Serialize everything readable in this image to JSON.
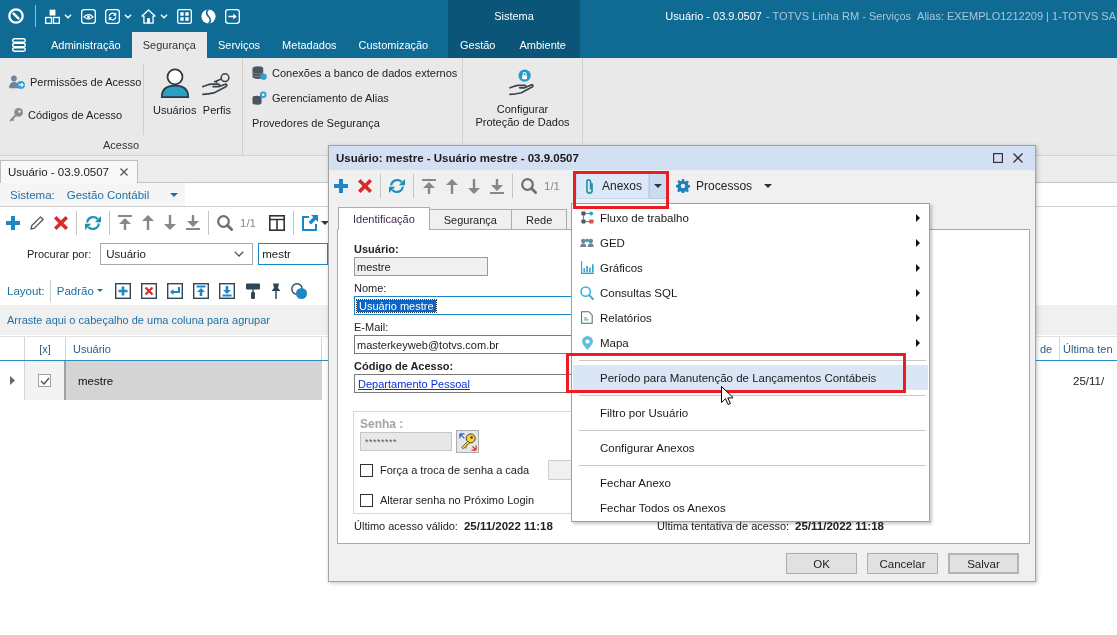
{
  "title_bar": {
    "title": "Usuário - 03.9.0507",
    "product": "- TOTVS Linha RM - Serviços",
    "alias": "Alias: EXEMPLO1212209 | 1-TOTVS SA"
  },
  "ribbon": {
    "tabs": [
      {
        "label": "Administração",
        "selected": false
      },
      {
        "label": "Segurança",
        "selected": true
      },
      {
        "label": "Serviços",
        "selected": false
      },
      {
        "label": "Metadados",
        "selected": false
      },
      {
        "label": "Customização",
        "selected": false
      }
    ],
    "context": {
      "label": "Sistema",
      "tabs": [
        {
          "label": "Gestão",
          "selected": false
        },
        {
          "label": "Ambiente",
          "selected": false
        }
      ]
    },
    "groups": [
      {
        "label": "Acesso",
        "small_buttons": [
          "Permissões de Acesso",
          "Códigos de Acesso"
        ],
        "large_buttons": [
          "Usuários",
          "Perfis"
        ]
      },
      {
        "small_buttons": [
          "Conexões a banco de dados externos",
          "Gerenciamento de Alias",
          "Provedores de Segurança"
        ]
      },
      {
        "large_buttons": [
          "Configurar Proteção de Dados"
        ]
      }
    ]
  },
  "document_tabs": [
    {
      "label": "Usuário - 03.9.0507",
      "selected": true
    }
  ],
  "system_selector": {
    "label": "Sistema:",
    "value": "Gestão Contábil"
  },
  "toolbar": {
    "record_counter": "1/1"
  },
  "search": {
    "label": "Procurar por:",
    "field": "Usuário",
    "value": "mestr"
  },
  "layout_bar": {
    "label": "Layout:",
    "value": "Padrão"
  },
  "group_panel": {
    "hint": "Arraste aqui o cabeçalho de uma coluna para agrupar"
  },
  "table": {
    "columns": [
      "[x]",
      "Usuário",
      "de",
      "Última ten"
    ],
    "rows": [
      {
        "current": true,
        "selected": true,
        "checked": true,
        "user": "mestre",
        "column_4": "25/11/"
      }
    ]
  },
  "dialog": {
    "title": "Usuário: mestre - Usuário mestre - 03.9.0507",
    "record_counter": "1/1",
    "toolbar_menus": [
      {
        "label": "Anexos",
        "open": true,
        "highlighted": true
      },
      {
        "label": "Processos",
        "open": false,
        "highlighted": false
      }
    ],
    "tabs": [
      {
        "label": "Identificação",
        "selected": true
      },
      {
        "label": "Segurança",
        "selected": false
      },
      {
        "label": "Rede",
        "selected": false
      }
    ],
    "fields": [
      {
        "label": "Usuário:",
        "required": true,
        "kind": "readonly",
        "value": "mestre",
        "text_selected": false
      },
      {
        "label": "Nome:",
        "required": false,
        "kind": "text",
        "value": "Usuário mestre",
        "text_selected": true
      },
      {
        "label": "E-Mail:",
        "required": false,
        "kind": "text",
        "value": "masterkeyweb@totvs.com.br",
        "text_selected": false
      },
      {
        "label": "Código de Acesso:",
        "required": true,
        "kind": "link",
        "value": "Departamento Pessoal",
        "text_selected": false
      }
    ],
    "password": {
      "label": "Senha :",
      "value": "********",
      "disabled": true
    },
    "options": [
      {
        "kind": "interval",
        "label": "Força a troca de senha a cada",
        "checked": false
      },
      {
        "kind": "plain",
        "label": "Alterar senha no Próximo Login",
        "checked": false
      }
    ],
    "last_access": {
      "label": "Último acesso válido:",
      "value": "25/11/2022 11:18"
    },
    "last_attempt": {
      "label": "Última tentativa de acesso:",
      "value": "25/11/2022 11:18"
    },
    "buttons": [
      {
        "label": "OK",
        "default": false
      },
      {
        "label": "Cancelar",
        "default": false
      },
      {
        "label": "Salvar",
        "default": true
      }
    ]
  },
  "attachments_menu": {
    "items": [
      {
        "kind": "item",
        "label": "Fluxo de trabalho",
        "submenu": true,
        "hovered": false,
        "highlighted": false
      },
      {
        "kind": "item",
        "label": "GED",
        "submenu": true,
        "hovered": false,
        "highlighted": false
      },
      {
        "kind": "item",
        "label": "Gráficos",
        "submenu": true,
        "hovered": false,
        "highlighted": false
      },
      {
        "kind": "item",
        "label": "Consultas SQL",
        "submenu": true,
        "hovered": false,
        "highlighted": false
      },
      {
        "kind": "item",
        "label": "Relatórios",
        "submenu": true,
        "hovered": false,
        "highlighted": false
      },
      {
        "kind": "item",
        "label": "Mapa",
        "submenu": true,
        "hovered": false,
        "highlighted": false
      },
      {
        "kind": "separator"
      },
      {
        "kind": "item",
        "label": "Período para Manutenção de Lançamentos Contábeis",
        "submenu": false,
        "hovered": true,
        "highlighted": true
      },
      {
        "kind": "separator"
      },
      {
        "kind": "item",
        "label": "Filtro por Usuário",
        "submenu": false,
        "hovered": false,
        "highlighted": false
      },
      {
        "kind": "separator"
      },
      {
        "kind": "item",
        "label": "Configurar Anexos",
        "submenu": false,
        "hovered": false,
        "highlighted": false
      },
      {
        "kind": "separator"
      },
      {
        "kind": "item",
        "label": "Fechar Anexo",
        "submenu": false,
        "hovered": false,
        "highlighted": false
      },
      {
        "kind": "item",
        "label": "Fechar Todos os Anexos",
        "submenu": false,
        "hovered": false,
        "highlighted": false
      }
    ]
  }
}
